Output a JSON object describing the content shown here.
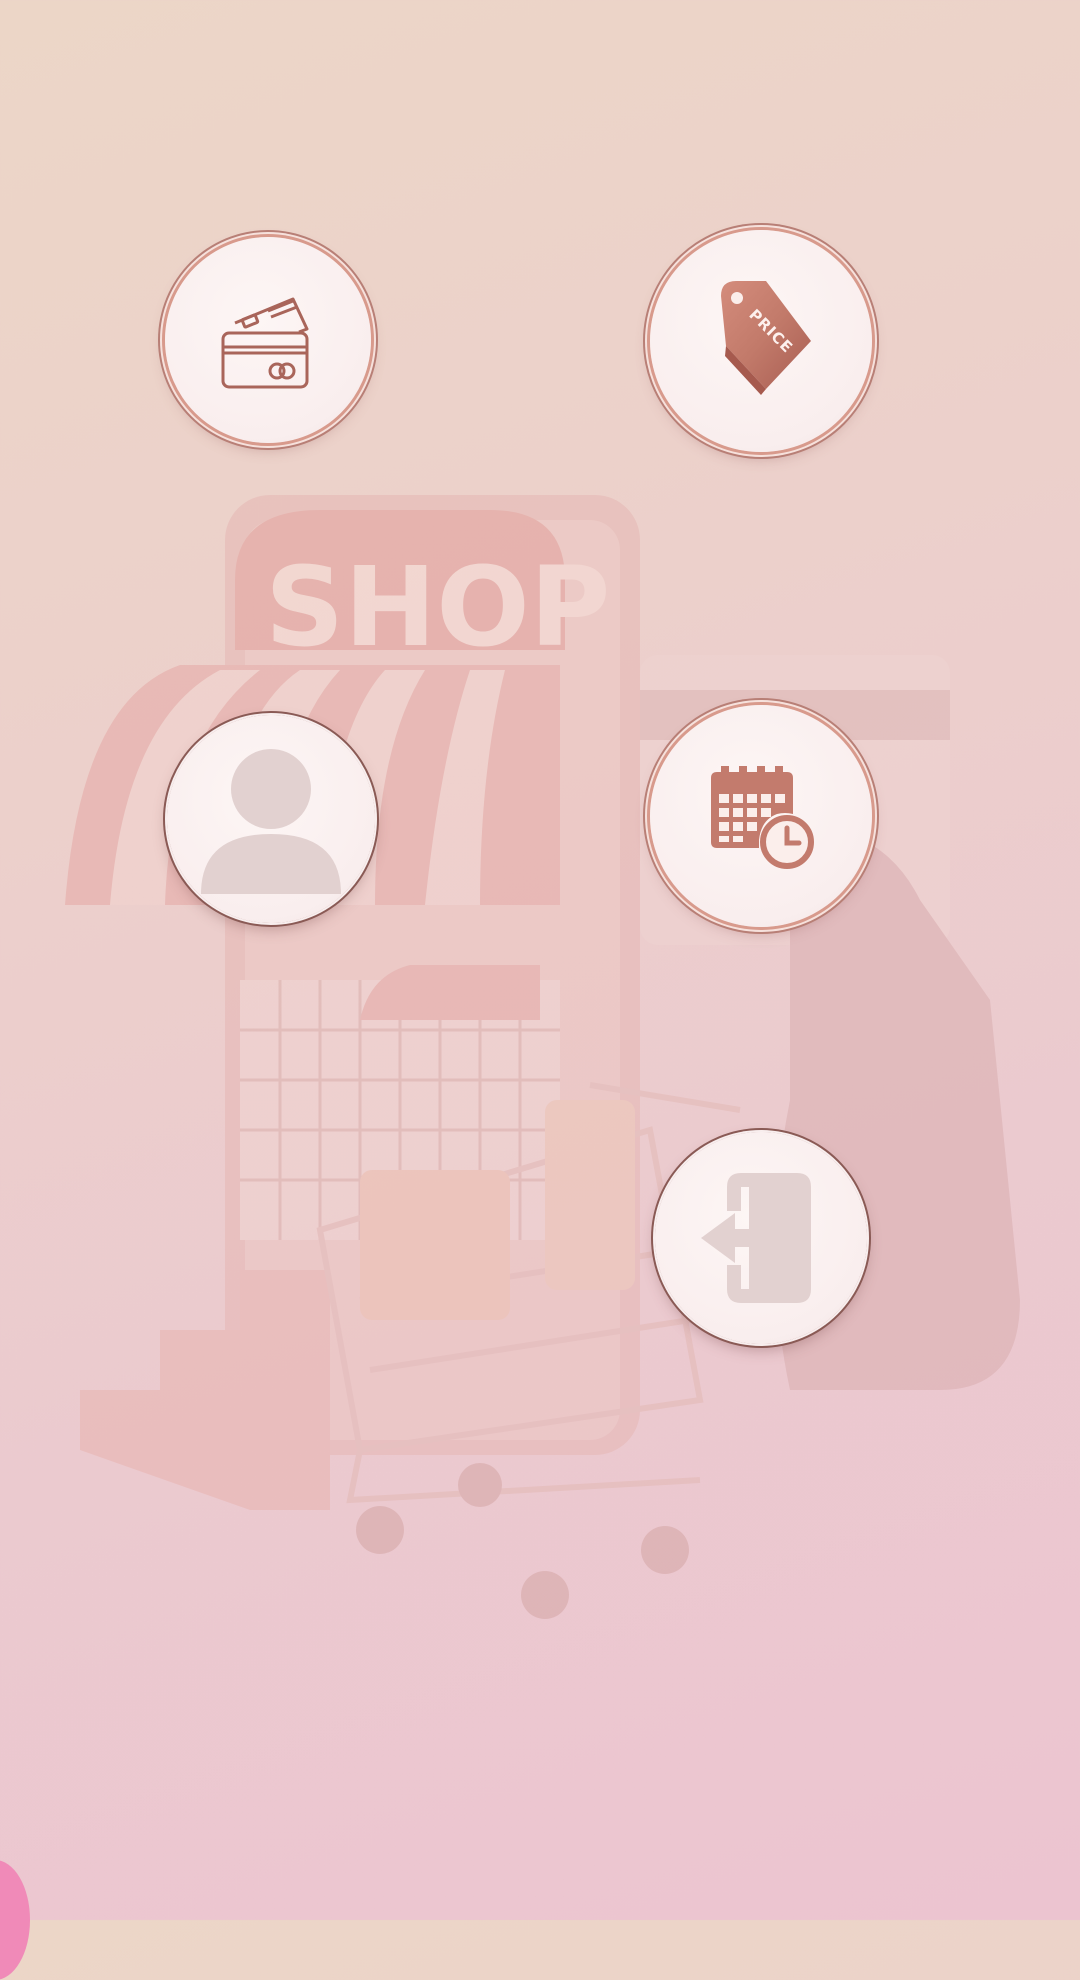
{
  "background": {
    "shop_sign": "SHOP",
    "colors": {
      "gradient_start": "#ecd6c7",
      "gradient_end": "#ecc4d0",
      "accent_rose_gold": "#c27a6a",
      "corner_accent": "#f08ab8"
    }
  },
  "menu": {
    "buttons": [
      {
        "name": "payment-button",
        "icon": "credit-cards-icon"
      },
      {
        "name": "price-button",
        "icon": "price-tag-icon",
        "tag_text": "PRICE"
      },
      {
        "name": "profile-button",
        "icon": "user-avatar-icon"
      },
      {
        "name": "schedule-button",
        "icon": "calendar-clock-icon"
      },
      {
        "name": "logout-button",
        "icon": "logout-door-icon"
      }
    ]
  }
}
